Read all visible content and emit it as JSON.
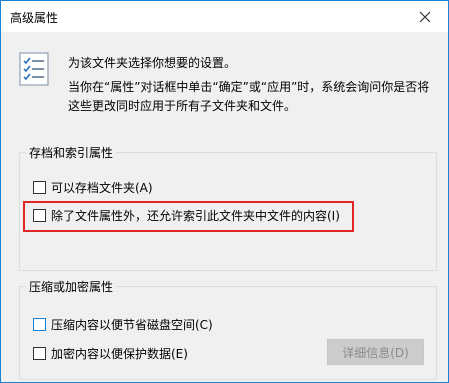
{
  "window": {
    "title": "高级属性",
    "close_icon": "close-icon"
  },
  "header": {
    "icon": "properties-list-icon",
    "intro": "为该文件夹选择你想要的设置。",
    "description": "当你在“属性”对话框中单击“确定”或“应用”时，系统会询问你是否将这些更改同时应用于所有子文件夹和文件。"
  },
  "archive_group": {
    "title": "存档和索引属性",
    "options": [
      {
        "label": "可以存档文件夹(A)",
        "checked": false
      },
      {
        "label": "除了文件属性外，还允许索引此文件夹中文件的内容(I)",
        "checked": false,
        "highlighted": true
      }
    ]
  },
  "compress_group": {
    "title": "压缩或加密属性",
    "options": [
      {
        "label": "压缩内容以便节省磁盘空间(C)",
        "checked": false
      },
      {
        "label": "加密内容以便保护数据(E)",
        "checked": false
      }
    ],
    "details_button": "详细信息(D)"
  },
  "colors": {
    "accent": "#1883d7",
    "highlight": "#e02727",
    "dialog_bg": "#f0f0f0",
    "disabled_text": "#8a8a8a"
  }
}
